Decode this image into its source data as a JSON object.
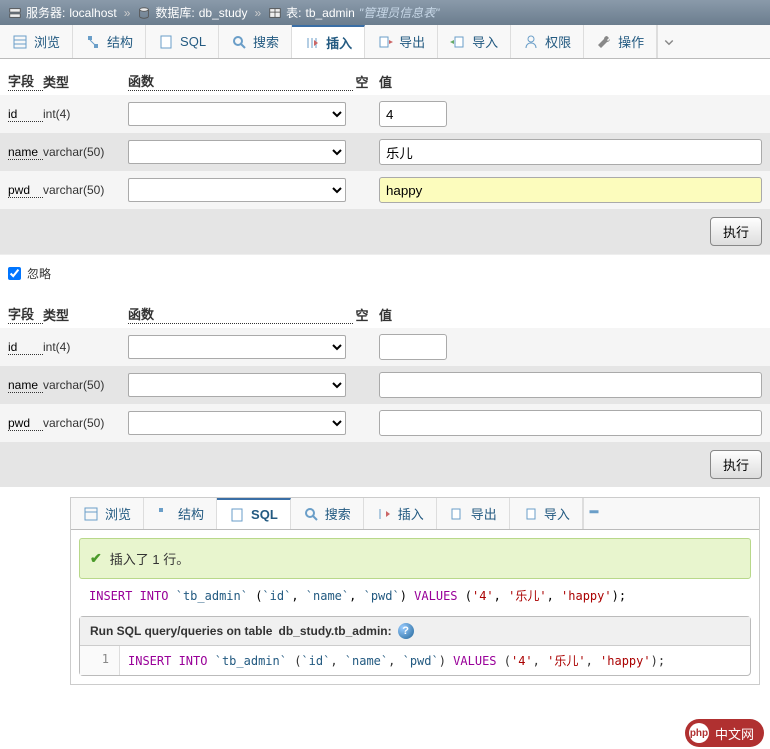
{
  "breadcrumb": {
    "server_label": "服务器:",
    "server_value": "localhost",
    "db_label": "数据库:",
    "db_value": "db_study",
    "table_label": "表:",
    "table_value": "tb_admin",
    "comment": "\"管理员信息表\""
  },
  "tabs": {
    "browse": "浏览",
    "struct": "结构",
    "sql": "SQL",
    "search": "搜索",
    "insert": "插入",
    "export": "导出",
    "import": "导入",
    "priv": "权限",
    "op": "操作"
  },
  "headers": {
    "field": "字段",
    "type": "类型",
    "func": "函数",
    "null": "空",
    "value": "值"
  },
  "form1": {
    "rows": [
      {
        "field": "id",
        "type": "int(4)",
        "value": "4",
        "short": true
      },
      {
        "field": "name",
        "type": "varchar(50)",
        "value": "乐儿",
        "short": false
      },
      {
        "field": "pwd",
        "type": "varchar(50)",
        "value": "happy",
        "short": false,
        "hl": true
      }
    ],
    "submit": "执行"
  },
  "ignore": {
    "label": "忽略"
  },
  "form2": {
    "rows": [
      {
        "field": "id",
        "type": "int(4)",
        "value": "",
        "short": true
      },
      {
        "field": "name",
        "type": "varchar(50)",
        "value": "",
        "short": false
      },
      {
        "field": "pwd",
        "type": "varchar(50)",
        "value": "",
        "short": false
      }
    ],
    "submit": "执行"
  },
  "panel2": {
    "tabs": {
      "browse": "浏览",
      "struct": "结构",
      "sql": "SQL",
      "search": "搜索",
      "insert": "插入",
      "export": "导出",
      "import": "导入"
    },
    "success": "插入了 1 行。",
    "sql_display": "INSERT INTO `tb_admin` (`id`, `name`, `pwd`) VALUES ('4', '乐儿', 'happy');",
    "query_title_prefix": "Run SQL query/queries on table",
    "query_title_table": "db_study.tb_admin:",
    "line_no": "1",
    "line_sql": "INSERT INTO `tb_admin` (`id`, `name`, `pwd`) VALUES ('4', '乐儿', 'happy');"
  },
  "watermark": {
    "logo": "php",
    "text": "中文网"
  }
}
